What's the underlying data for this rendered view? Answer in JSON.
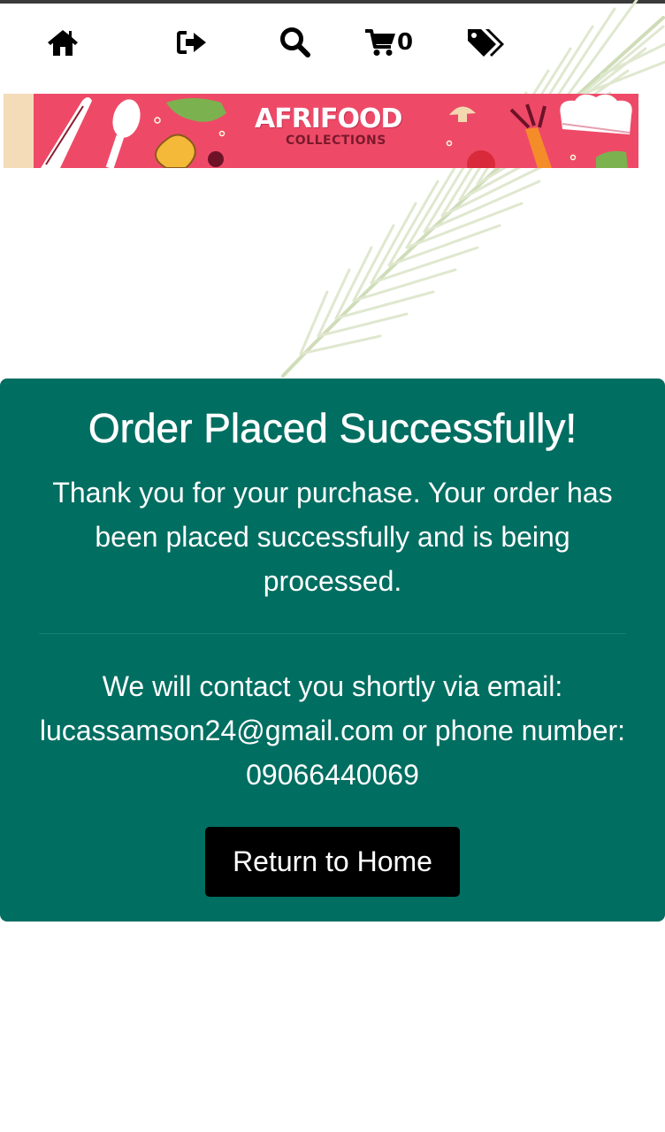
{
  "nav": {
    "icons": [
      "home-icon",
      "logout-icon",
      "search-icon",
      "cart-icon",
      "tags-icon"
    ],
    "cart_count": "0"
  },
  "banner": {
    "brand": "AFRIFOOD",
    "sub": "COLLECTIONS"
  },
  "order": {
    "title": "Order Placed Successfully!",
    "message": "Thank you for your purchase. Your order has been placed successfully and is being processed.",
    "contact": "We will contact you shortly via email: lucassamson24@gmail.com or phone number: 09066440069",
    "button_label": "Return to Home"
  },
  "colors": {
    "card_bg": "#006e61",
    "banner_bg": "#ee4a68",
    "button_bg": "#000000"
  }
}
